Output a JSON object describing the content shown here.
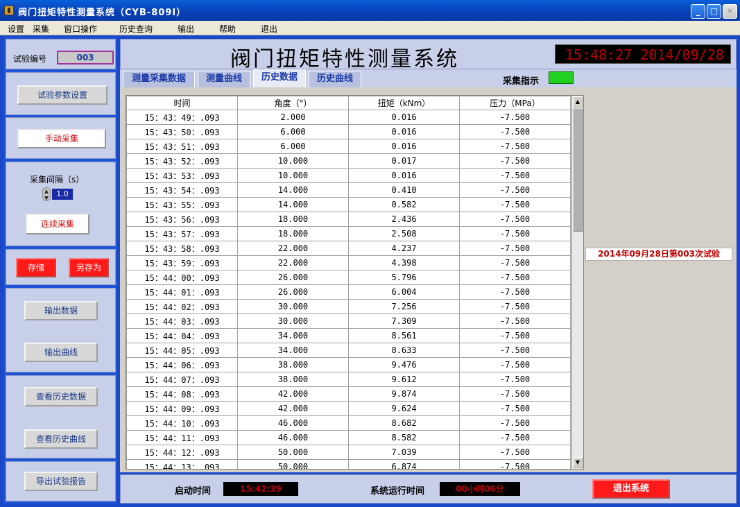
{
  "window": {
    "title": "阀门扭矩特性测量系统（CYB-809I）"
  },
  "menu": [
    "设置",
    "采集",
    "窗口操作",
    "历史查询",
    "输出",
    "帮助",
    "退出"
  ],
  "sidebar": {
    "trial_label": "试验编号",
    "trial_number": "003",
    "param_button": "试验参数设置",
    "manual_button": "手动采集",
    "interval_label": "采集间隔（s）",
    "interval_value": "1.0",
    "continuous_button": "连续采集",
    "save_button": "存储",
    "save_as_button": "另存为",
    "export_data_button": "输出数据",
    "export_curve_button": "输出曲线",
    "history_data_button": "查看历史数据",
    "history_curve_button": "查看历史曲线",
    "report_button": "导出试验报告"
  },
  "header": {
    "system_title": "阀门扭矩特性测量系统",
    "clock": "15:48:27  2014/09/28"
  },
  "tabs": [
    {
      "label": "测量采集数据",
      "active": false
    },
    {
      "label": "测量曲线",
      "active": false
    },
    {
      "label": "历史数据",
      "active": true
    },
    {
      "label": "历史曲线",
      "active": false
    }
  ],
  "indicator": {
    "label": "采集指示",
    "color": "#22d022"
  },
  "table": {
    "columns": [
      "时间",
      "角度（°）",
      "扭矩（kNm）",
      "压力（MPa）"
    ],
    "rows": [
      [
        "15：43：49：.093",
        "2.000",
        "0.016",
        "-7.500"
      ],
      [
        "15：43：50：.093",
        "6.000",
        "0.016",
        "-7.500"
      ],
      [
        "15：43：51：.093",
        "6.000",
        "0.016",
        "-7.500"
      ],
      [
        "15：43：52：.093",
        "10.000",
        "0.017",
        "-7.500"
      ],
      [
        "15：43：53：.093",
        "10.000",
        "0.016",
        "-7.500"
      ],
      [
        "15：43：54：.093",
        "14.000",
        "0.410",
        "-7.500"
      ],
      [
        "15：43：55：.093",
        "14.000",
        "0.582",
        "-7.500"
      ],
      [
        "15：43：56：.093",
        "18.000",
        "2.436",
        "-7.500"
      ],
      [
        "15：43：57：.093",
        "18.000",
        "2.508",
        "-7.500"
      ],
      [
        "15：43：58：.093",
        "22.000",
        "4.237",
        "-7.500"
      ],
      [
        "15：43：59：.093",
        "22.000",
        "4.398",
        "-7.500"
      ],
      [
        "15：44：00：.093",
        "26.000",
        "5.796",
        "-7.500"
      ],
      [
        "15：44：01：.093",
        "26.000",
        "6.004",
        "-7.500"
      ],
      [
        "15：44：02：.093",
        "30.000",
        "7.256",
        "-7.500"
      ],
      [
        "15：44：03：.093",
        "30.000",
        "7.309",
        "-7.500"
      ],
      [
        "15：44：04：.093",
        "34.000",
        "8.561",
        "-7.500"
      ],
      [
        "15：44：05：.093",
        "34.000",
        "8.633",
        "-7.500"
      ],
      [
        "15：44：06：.093",
        "38.000",
        "9.476",
        "-7.500"
      ],
      [
        "15：44：07：.093",
        "38.000",
        "9.612",
        "-7.500"
      ],
      [
        "15：44：08：.093",
        "42.000",
        "9.874",
        "-7.500"
      ],
      [
        "15：44：09：.093",
        "42.000",
        "9.624",
        "-7.500"
      ],
      [
        "15：44：10：.093",
        "46.000",
        "8.682",
        "-7.500"
      ],
      [
        "15：44：11：.093",
        "46.000",
        "8.582",
        "-7.500"
      ],
      [
        "15：44：12：.093",
        "50.000",
        "7.039",
        "-7.500"
      ],
      [
        "15：44：13：.093",
        "50.000",
        "6.874",
        "-7.500"
      ]
    ]
  },
  "trial_caption": "2014年09月28日第003次试验",
  "status": {
    "start_label": "启动时间",
    "start_value": "15:42:39",
    "runtime_label": "系统运行时间",
    "runtime_value": "00小时06分",
    "exit_button": "退出系统"
  }
}
